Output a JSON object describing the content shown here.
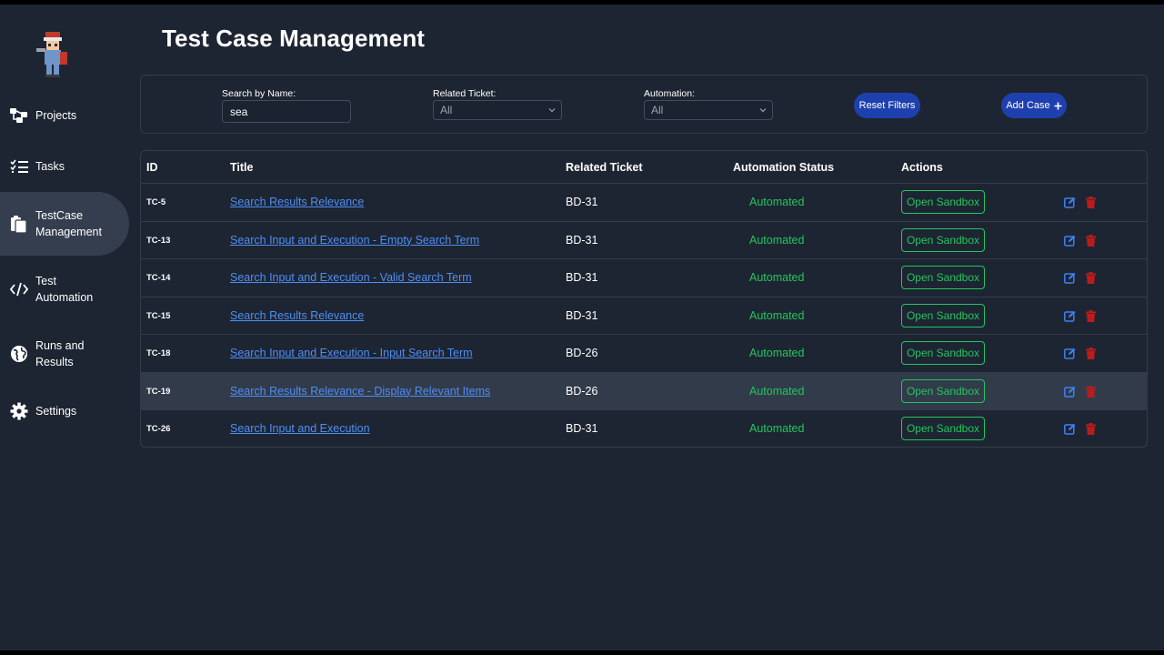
{
  "app": {
    "page_title": "Test Case Management"
  },
  "sidebar": {
    "items": [
      {
        "label": "Projects",
        "icon": "projects-icon"
      },
      {
        "label": "Tasks",
        "icon": "tasks-icon"
      },
      {
        "label": "TestCase Management",
        "icon": "clipboard-icon",
        "active": true
      },
      {
        "label": "Test Automation",
        "icon": "code-icon"
      },
      {
        "label": "Runs and Results",
        "icon": "globe-icon"
      },
      {
        "label": "Settings",
        "icon": "gear-icon"
      }
    ]
  },
  "filters": {
    "search_label": "Search by Name:",
    "search_value": "sea",
    "ticket_label": "Related Ticket:",
    "ticket_value": "All",
    "automation_label": "Automation:",
    "automation_value": "All",
    "reset_label": "Reset Filters",
    "add_label": "Add Case"
  },
  "table": {
    "headers": [
      "ID",
      "Title",
      "Related Ticket",
      "Automation Status",
      "Actions"
    ],
    "sandbox_label": "Open Sandbox",
    "rows": [
      {
        "id": "TC-5",
        "title": "Search Results Relevance",
        "ticket": "BD-31",
        "status": "Automated"
      },
      {
        "id": "TC-13",
        "title": "Search Input and Execution - Empty Search Term",
        "ticket": "BD-31",
        "status": "Automated"
      },
      {
        "id": "TC-14",
        "title": "Search Input and Execution - Valid Search Term",
        "ticket": "BD-31",
        "status": "Automated"
      },
      {
        "id": "TC-15",
        "title": "Search Results Relevance",
        "ticket": "BD-31",
        "status": "Automated"
      },
      {
        "id": "TC-18",
        "title": "Search Input and Execution - Input Search Term",
        "ticket": "BD-26",
        "status": "Automated"
      },
      {
        "id": "TC-19",
        "title": "Search Results Relevance - Display Relevant Items",
        "ticket": "BD-26",
        "status": "Automated",
        "highlighted": true
      },
      {
        "id": "TC-26",
        "title": "Search Input and Execution",
        "ticket": "BD-31",
        "status": "Automated"
      }
    ]
  },
  "colors": {
    "background": "#1e2532",
    "accent_blue": "#1e40af",
    "link": "#4d8ef5",
    "status_green": "#22c55e",
    "delete_red": "#b91c1c"
  }
}
